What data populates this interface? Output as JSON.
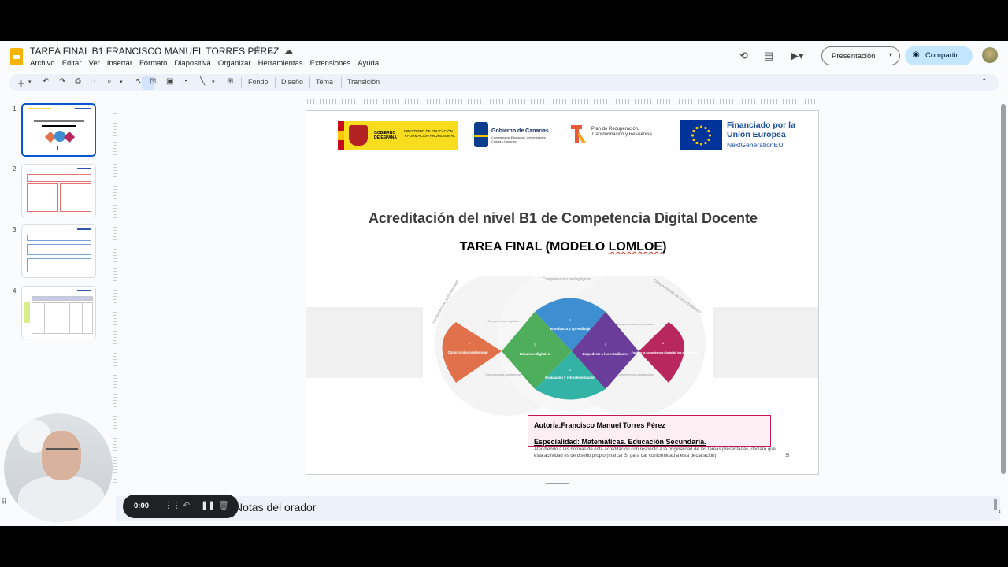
{
  "app": {
    "doc_title": "TAREA FINAL B1 FRANCISCO MANUEL TORRES PÉREZ",
    "menu": [
      "Archivo",
      "Editar",
      "Ver",
      "Insertar",
      "Formato",
      "Diapositiva",
      "Organizar",
      "Herramientas",
      "Extensiones",
      "Ayuda"
    ],
    "present_label": "Presentación",
    "share_label": "Compartir"
  },
  "toolbar": {
    "fondo": "Fondo",
    "diseno": "Diseño",
    "tema": "Tema",
    "transicion": "Transición"
  },
  "filmstrip": [
    "1",
    "2",
    "3",
    "4"
  ],
  "slide": {
    "logos": {
      "spain_gov": "GOBIERNO DE ESPAÑA",
      "spain_ministry": "MINISTERIO DE EDUCACIÓN Y FORMACIÓN PROFESIONAL",
      "canarias_title": "Gobierno de Canarias",
      "canarias_sub": "Consejería de Educación, Universidades, Cultura y Deportes",
      "prtr": "Plan de Recuperación, Transformación y Resiliencia",
      "eu_title": "Financiado por la Unión Europea",
      "eu_sub": "NextGenerationEU"
    },
    "title": "Acreditación del nivel B1 de Competencia Digital Docente",
    "subtitle_pre": "TAREA FINAL (MODELO ",
    "subtitle_lom": "LOMLOE",
    "subtitle_post": ")",
    "diagram": {
      "outer_labels": [
        "Competencias profesionales",
        "Competencias pedagógicas",
        "Competencias de los estudiantes"
      ],
      "petals": [
        {
          "num": "1",
          "label": "Compromiso profesional",
          "color": "#e0714a"
        },
        {
          "num": "2",
          "label": "Recursos digitales",
          "color": "#4fae5b"
        },
        {
          "num": "3",
          "label": "Enseñanza y aprendizaje",
          "color": "#3d8fd1"
        },
        {
          "num": "4",
          "label": "Evaluación y retroalimentación",
          "color": "#33b3a6"
        },
        {
          "num": "5",
          "label": "Empoderar a los estudiantes",
          "color": "#6a3d9a"
        },
        {
          "num": "6",
          "label": "Facilitar la competencia digital de los estudiantes",
          "color": "#b8285f"
        }
      ],
      "small_labels": [
        "Competencias digitales",
        "Competencias académicas",
        "Competencias transversales",
        "Competencias académicas"
      ]
    },
    "author": "Autoría:Francisco Manuel Torres Pérez",
    "speciality": "Especialidad: Matemáticas. Educación Secundaria.",
    "disclaimer": "Atendiendo a las normas de esta acreditación con respecto a la originalidad de las tareas presentadas, declaro que esta actividad es de diseño propio (marcar SI para dar conformidad a esta declaración):",
    "disclaimer_answer": "Si"
  },
  "notes": {
    "label": "Notas del orador"
  },
  "recorder": {
    "time": "0:00"
  }
}
